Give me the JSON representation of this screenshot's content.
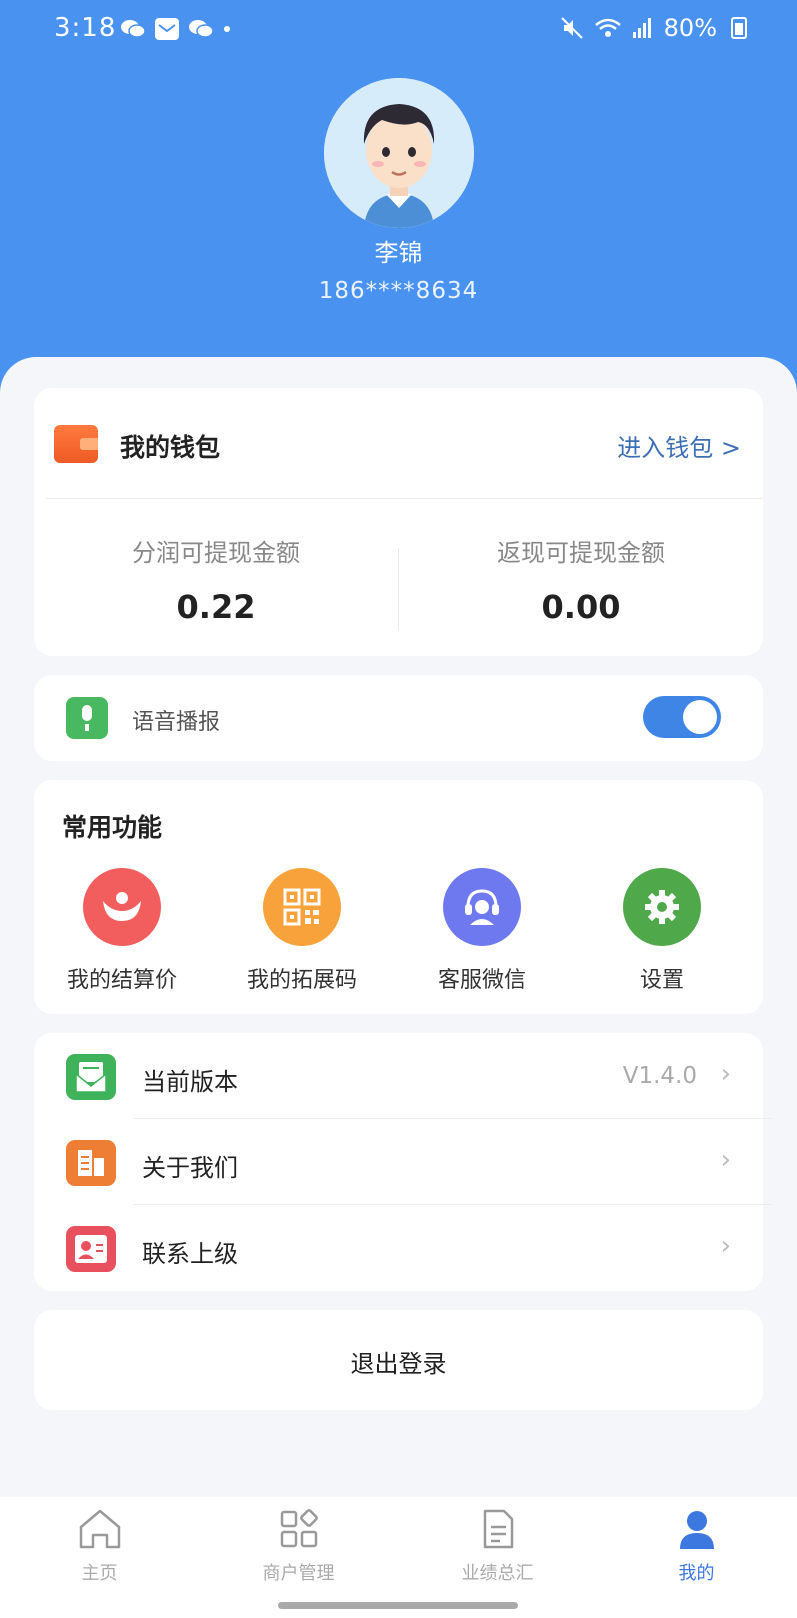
{
  "status_bar": {
    "time": "3:18",
    "battery": "80%"
  },
  "profile": {
    "name": "李锦",
    "phone": "186****8634"
  },
  "wallet": {
    "title": "我的钱包",
    "enter_label": "进入钱包 >",
    "profit_label": "分润可提现金额",
    "profit_value": "0.22",
    "cashback_label": "返现可提现金额",
    "cashback_value": "0.00"
  },
  "voice": {
    "label": "语音播报",
    "enabled": true
  },
  "functions": {
    "title": "常用功能",
    "items": [
      {
        "label": "我的结算价",
        "icon": "settlement-icon",
        "color": "#f25e5e"
      },
      {
        "label": "我的拓展码",
        "icon": "qr-code-icon",
        "color": "#f7a23b"
      },
      {
        "label": "客服微信",
        "icon": "customer-service-icon",
        "color": "#6f79ef"
      },
      {
        "label": "设置",
        "icon": "gear-icon",
        "color": "#4fa849"
      }
    ]
  },
  "menu": [
    {
      "label": "当前版本",
      "value": "V1.4.0",
      "icon": "version-icon"
    },
    {
      "label": "关于我们",
      "value": "",
      "icon": "about-icon"
    },
    {
      "label": "联系上级",
      "value": "",
      "icon": "contact-icon"
    }
  ],
  "logout": {
    "label": "退出登录"
  },
  "tabs": [
    {
      "label": "主页",
      "icon": "home-icon"
    },
    {
      "label": "商户管理",
      "icon": "merchant-icon"
    },
    {
      "label": "业绩总汇",
      "icon": "report-icon"
    },
    {
      "label": "我的",
      "icon": "user-icon",
      "active": true
    }
  ],
  "colors": {
    "header": "#4a92f0",
    "accent": "#3d78e0",
    "background": "#f4f6fa"
  }
}
